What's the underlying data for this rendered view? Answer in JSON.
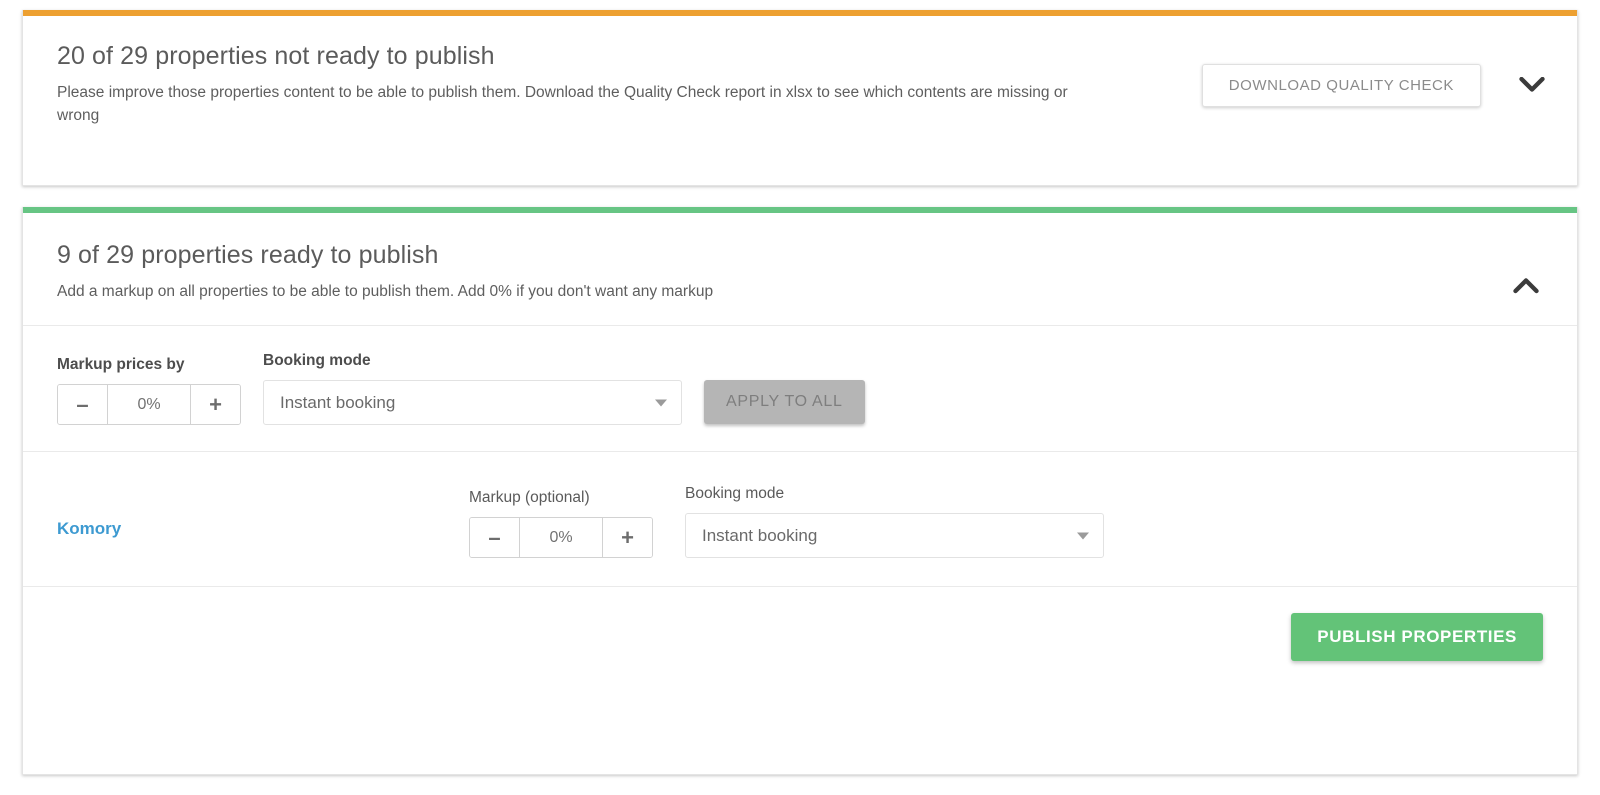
{
  "colors": {
    "accent_not_ready": "#eda031",
    "accent_ready": "#67c584",
    "link": "#3d9ad1",
    "publish_button": "#63c378",
    "apply_button_disabled": "#b5b5b5"
  },
  "not_ready_card": {
    "title": "20 of 29 properties not ready to publish",
    "subtitle": "Please improve those properties content to be able to publish them. Download the Quality Check report in xlsx to see which contents are missing or wrong",
    "download_button": "DOWNLOAD QUALITY CHECK",
    "toggle_icon": "chevron-down-icon"
  },
  "ready_card": {
    "title": "9 of 29 properties ready to publish",
    "subtitle": "Add a markup on all properties to be able to publish them. Add 0% if you don't want any markup",
    "toggle_icon": "chevron-up-icon",
    "bulk": {
      "markup_label": "Markup prices by",
      "markup_value": "0%",
      "decrement_label": "–",
      "increment_label": "+",
      "booking_mode_label": "Booking mode",
      "booking_mode_value": "Instant booking",
      "booking_mode_options": [
        "Instant booking"
      ],
      "apply_button": "APPLY TO ALL"
    },
    "property_column_headers": {
      "markup": "Markup (optional)",
      "booking_mode": "Booking mode"
    },
    "properties": [
      {
        "name": "Komory",
        "markup_value": "0%",
        "decrement_label": "–",
        "increment_label": "+",
        "booking_mode_value": "Instant booking",
        "booking_mode_options": [
          "Instant booking"
        ]
      }
    ],
    "publish_button": "PUBLISH PROPERTIES"
  }
}
